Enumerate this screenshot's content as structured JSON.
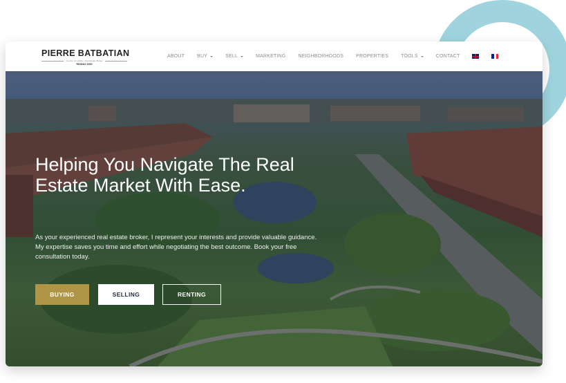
{
  "brand": {
    "name": "PIERRE BATBATIAN",
    "tagline": "Courtier immobilier • Real Estate Broker",
    "agency": "RE/MAX 2000"
  },
  "nav": {
    "items": [
      {
        "label": "ABOUT",
        "dropdown": false
      },
      {
        "label": "BUY",
        "dropdown": true
      },
      {
        "label": "SELL",
        "dropdown": true
      },
      {
        "label": "MARKETING",
        "dropdown": false
      },
      {
        "label": "NEIGHBORHOODS",
        "dropdown": false
      },
      {
        "label": "PROPERTIES",
        "dropdown": false
      },
      {
        "label": "TOOLS",
        "dropdown": true
      },
      {
        "label": "CONTACT",
        "dropdown": false
      }
    ],
    "languages": [
      "uk-flag-icon",
      "france-flag-icon"
    ]
  },
  "hero": {
    "headline": "Helping You Navigate The Real Estate Market With Ease.",
    "subtext": "As your experienced real estate broker, I represent your interests and provide valuable guidance. My expertise saves you time and effort while negotiating the best outcome. Book your free consultation today.",
    "buttons": {
      "buying": "BUYING",
      "selling": "SELLING",
      "renting": "RENTING"
    }
  },
  "colors": {
    "accent_gold": "#b09547",
    "decor_circle": "#9fd4de",
    "nav_text": "#8b8b8b"
  }
}
